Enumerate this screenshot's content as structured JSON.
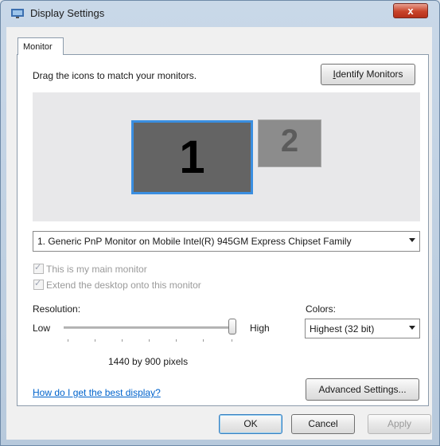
{
  "window": {
    "title": "Display Settings",
    "close_label": "x"
  },
  "tab": {
    "label": "Monitor"
  },
  "instructions": "Drag the icons to match your monitors.",
  "identify_button": "Identify Monitors",
  "monitors": [
    {
      "number": "1"
    },
    {
      "number": "2"
    }
  ],
  "monitor_select": {
    "value": "1. Generic PnP Monitor on Mobile Intel(R) 945GM Express Chipset Family"
  },
  "checkboxes": [
    {
      "label": "This is my main monitor",
      "checked": true,
      "enabled": false
    },
    {
      "label": "Extend the desktop onto this monitor",
      "checked": true,
      "enabled": false
    }
  ],
  "resolution": {
    "label": "Resolution:",
    "low": "Low",
    "high": "High",
    "value_text": "1440 by 900 pixels",
    "level": 1.0
  },
  "colors": {
    "label": "Colors:",
    "value": "Highest (32 bit)"
  },
  "help_link": "How do I get the best display?",
  "advanced_button": "Advanced Settings...",
  "footer": {
    "ok": "OK",
    "cancel": "Cancel",
    "apply": "Apply"
  },
  "accent_colors": {
    "selection_border": "#3a8ee0",
    "link": "#0063cc",
    "close_button": "#c8432a"
  }
}
